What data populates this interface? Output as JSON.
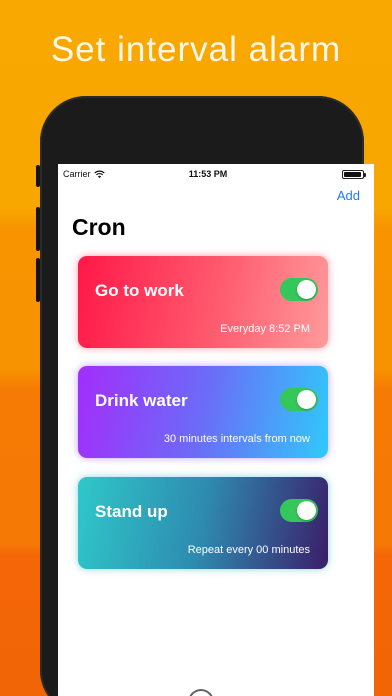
{
  "headline": "Set interval alarm",
  "status_bar": {
    "carrier": "Carrier",
    "wifi_icon": "wifi-icon",
    "time": "11:53 PM",
    "battery_icon": "battery-icon"
  },
  "nav": {
    "add_label": "Add",
    "title": "Cron"
  },
  "alarms": [
    {
      "name": "Go to work",
      "schedule": "Everyday 8:52 PM",
      "enabled": true
    },
    {
      "name": "Drink water",
      "schedule": "30 minutes intervals from now",
      "enabled": true
    },
    {
      "name": "Stand up",
      "schedule": "Repeat every 00 minutes",
      "enabled": true
    }
  ],
  "colors": {
    "accent": "#1a7ef5",
    "toggle_on": "#34c759",
    "background_orange": "#f79200"
  }
}
